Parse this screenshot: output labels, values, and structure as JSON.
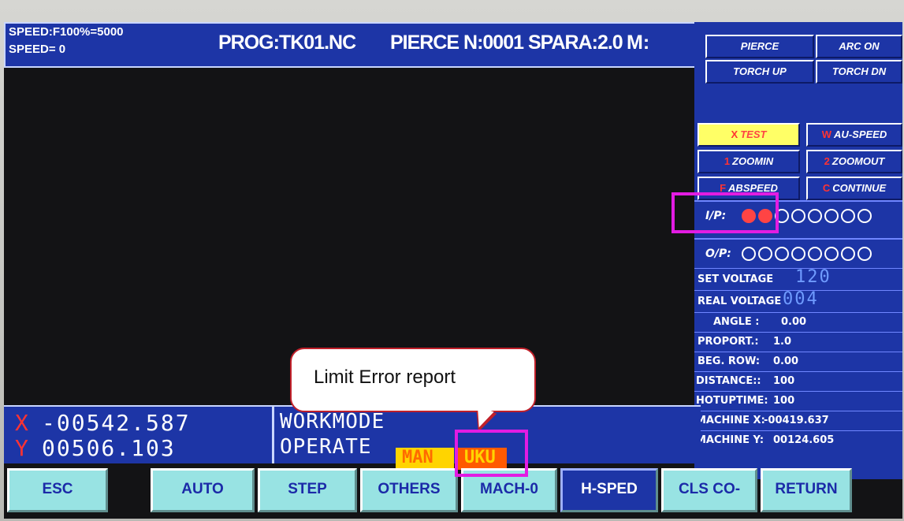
{
  "header": {
    "speed_line1": "SPEED:F100%=5000",
    "speed_line2": "SPEED=  0",
    "program": "PROG:TK01.NC",
    "pierce_info": "PIERCE N:0001  SPARA:2.0",
    "m_label": "M:"
  },
  "right_panel": {
    "buttons": [
      {
        "label": "PIERCE"
      },
      {
        "label": "ARC ON"
      },
      {
        "label": "TORCH UP"
      },
      {
        "label": "TORCH DN"
      },
      {
        "key": "X",
        "label": "TEST",
        "highlighted": true
      },
      {
        "key": "W",
        "label": "AU-SPEED"
      },
      {
        "key": "1",
        "label": "ZOOMIN"
      },
      {
        "key": "2",
        "label": "ZOOMOUT"
      },
      {
        "key": "F",
        "label": "ABSPEED"
      },
      {
        "key": "C",
        "label": "CONTINUE"
      }
    ],
    "inputs_label": "I/P:",
    "inputs_states": [
      1,
      1,
      0,
      0,
      0,
      0,
      0,
      0
    ],
    "outputs_label": "O/P:",
    "outputs_states": [
      0,
      0,
      0,
      0,
      0,
      0,
      0,
      0
    ],
    "set_voltage_label": "SET VOLTAGE",
    "set_voltage_value": "120",
    "real_voltage_label": "REAL VOLTAGE",
    "real_voltage_value": "004",
    "params": [
      {
        "label": "ANGLE :",
        "value": "0.00"
      },
      {
        "label": "PROPORT.:",
        "value": "1.0"
      },
      {
        "label": "BEG. ROW:",
        "value": "0.00"
      },
      {
        "label": "DISTANCE::",
        "value": "100"
      },
      {
        "label": "HOTUPTIME:",
        "value": "100"
      },
      {
        "label": "MACHINE X:",
        "value": "-00419.637"
      },
      {
        "label": "MACHINE Y:",
        "value": "00124.605"
      }
    ]
  },
  "coords": {
    "x_label": "X",
    "x_value": "-00542.587",
    "y_label": "Y",
    "y_value": "00506.103",
    "workmode_label": "WORKMODE",
    "operate_label": "OPERATE",
    "mode_main": "MAN",
    "mode_sub": "UKU"
  },
  "softkeys": [
    "ESC",
    "AUTO",
    "STEP",
    "OTHERS",
    "MACH-0",
    "H-SPED",
    "CLS CO-",
    "RETURN"
  ],
  "callout": {
    "text": "Limit Error report"
  },
  "colors": {
    "panel_blue": "#1d35a6",
    "softkey": "#98e3e3",
    "highlight": "#e21ce2",
    "active_input": "#ff4444"
  }
}
